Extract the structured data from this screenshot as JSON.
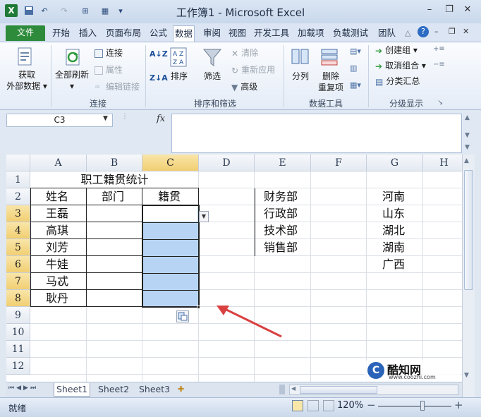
{
  "window": {
    "title": "工作簿1 - Microsoft Excel",
    "min": "–",
    "restore": "❐",
    "close": "✕"
  },
  "qat": {
    "save_icon": "save-icon",
    "undo": "↶",
    "redo": "↷"
  },
  "tabs": [
    "文件",
    "开始",
    "插入",
    "页面布局",
    "公式",
    "数据",
    "审阅",
    "视图",
    "开发工具",
    "加载项",
    "负载测试",
    "团队"
  ],
  "active_tab": "数据",
  "ribbon": {
    "get_external": [
      "获取",
      "外部数据 ▾"
    ],
    "refresh_all": [
      "全部刷新",
      "▾"
    ],
    "connections": "连接",
    "properties": "属性",
    "edit_links": "编辑链接",
    "group_connections": "连接",
    "sort_az": "A↓Z",
    "sort_za": "Z↓A",
    "sort": "排序",
    "filter": "筛选",
    "clear": "清除",
    "reapply": "重新应用",
    "advanced": "高级",
    "group_sort_filter": "排序和筛选",
    "text_to_columns": "分列",
    "remove_duplicates": [
      "删除",
      "重复项"
    ],
    "group_data_tools": "数据工具",
    "group": "创建组 ▾",
    "ungroup": "取消组合 ▾",
    "subtotal": "分类汇总",
    "group_outline": "分级显示"
  },
  "formula_bar": {
    "name_box": "C3",
    "fx": "fx",
    "formula": ""
  },
  "sheet": {
    "columns": [
      "A",
      "B",
      "C",
      "D",
      "E",
      "F",
      "G",
      "H"
    ],
    "rows": [
      "1",
      "2",
      "3",
      "4",
      "5",
      "6",
      "7",
      "8",
      "9",
      "10",
      "11",
      "12"
    ],
    "selected_col": "C",
    "selected_rows": [
      "3",
      "4",
      "5",
      "6",
      "7",
      "8"
    ],
    "cells": {
      "title": "职工籍贯统计",
      "A2": "姓名",
      "B2": "部门",
      "C2": "籍贯",
      "A3": "王磊",
      "A4": "高琪",
      "A5": "刘芳",
      "A6": "牛娃",
      "A7": "马忒",
      "A8": "耿丹",
      "E2": "财务部",
      "E3": "行政部",
      "E4": "技术部",
      "E5": "销售部",
      "G2": "河南",
      "G3": "山东",
      "G4": "湖北",
      "G5": "湖南",
      "G6": "广西"
    }
  },
  "sheet_tabs": [
    "Sheet1",
    "Sheet2",
    "Sheet3"
  ],
  "status": {
    "ready": "就绪",
    "zoom": "120%",
    "minus": "−",
    "plus": "+"
  },
  "watermark": {
    "brand": "酷知网",
    "url": "www.coozhi.com"
  },
  "colors": {
    "selection": "#b8d4f5",
    "file_tab": "#2e8b3b",
    "arrow": "#d94040"
  }
}
